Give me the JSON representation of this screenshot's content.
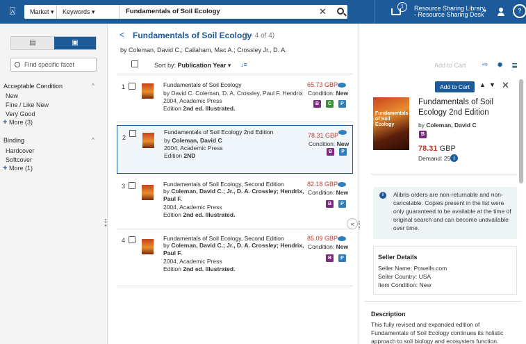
{
  "topbar": {
    "logo_icon": "alma-logo-icon",
    "market_label": "Market ▾",
    "keywords_label": "Keywords ▾",
    "search_value": "Fundamentals of Soil Ecology",
    "clear_glyph": "✕",
    "cart_badge": "1",
    "library_line1": "Resource Sharing Library",
    "library_line2": "- Resource Sharing Desk",
    "chev": "▾",
    "help_label": "?",
    "brand_color": "#1c5a9a"
  },
  "facets": {
    "list_view_glyph": "▤",
    "grid_view_glyph": "▣",
    "search_placeholder": "Find specific facet",
    "groups": [
      {
        "heading": "Acceptable Condition",
        "caret": "^",
        "items": [
          "New",
          "Fine / Like New",
          "Very Good"
        ],
        "more": "More (3)"
      },
      {
        "heading": "Binding",
        "caret": "^",
        "items": [
          "Hardcover",
          "Softcover"
        ],
        "more": "More (1)"
      }
    ],
    "more_plus": "+"
  },
  "results": {
    "back": "<",
    "title": "Fundamentals of Soil Ecology",
    "count": "(1 - 4 of 4)",
    "authors": "by Coleman, David C.; Callaham, Mac A.; Crossley Jr., D. A.",
    "sort_label": "Sort by:",
    "sort_value": "Publication Year",
    "sort_caret": "▾",
    "sort_order_icon": "↓≡",
    "rows": [
      {
        "num": "1",
        "title": "Fundamentals of Soil Ecology",
        "by_prefix": "by ",
        "by": "David C. Coleman, D. A. Crossley, Paul F. Hendrix",
        "by2": "",
        "year": "2004, Academic Press",
        "ed_prefix": "Edition ",
        "edition": "2nd ed. Illustrated.",
        "price": "65.73",
        "currency": "GBP",
        "cond_label": "Condition:",
        "cond": "New",
        "badges": [
          "B",
          "C",
          "P"
        ]
      },
      {
        "num": "2",
        "title": "Fundamentals of Soil Ecology 2nd Edition",
        "by_prefix": "by ",
        "by": "Coleman, David C",
        "by2": "",
        "year": "2004, Academic Press",
        "ed_prefix": "Edition ",
        "edition": "2ND",
        "price": "78.31",
        "currency": "GBP",
        "cond_label": "Condition:",
        "cond": "New",
        "badges": [
          "B",
          "P"
        ]
      },
      {
        "num": "3",
        "title": "Fundamentals of Soil Ecology, Second Edition",
        "by_prefix": "by ",
        "by": "Coleman, David C.; Jr., D. A. Crossley; Hendrix,",
        "by2": "Paul F.",
        "year": "2004, Academic Press",
        "ed_prefix": "Edition ",
        "edition": "2nd ed. Illustrated.",
        "price": "82.18",
        "currency": "GBP",
        "cond_label": "Condition:",
        "cond": "New",
        "badges": [
          "B",
          "P"
        ]
      },
      {
        "num": "4",
        "title": "Fundamentals of Soil Ecology, Second Edition",
        "by_prefix": "by ",
        "by": "Coleman, David C.; Jr., D. A. Crossley; Hendrix,",
        "by2": "Paul F.",
        "year": "2004, Academic Press",
        "ed_prefix": "Edition ",
        "edition": "2nd ed. Illustrated.",
        "price": "85.09",
        "currency": "GBP",
        "cond_label": "Condition:",
        "cond": "New",
        "badges": [
          "B",
          "P"
        ]
      }
    ]
  },
  "detail": {
    "add_to_cart_dim": "Add to Cart",
    "add_to_cart": "Add to Cart",
    "nav_up": "▲",
    "nav_down": "▼",
    "close": "✕",
    "cover_text": "Fundamentals of Soil Ecology",
    "title": "Fundamentals of Soil Ecology 2nd Edition",
    "author_prefix": "by ",
    "author": "Coleman, David C",
    "price": "78.31",
    "currency": "GBP",
    "demand": "Demand: 25",
    "notice": "Alibris orders are non-returnable and non-cancelable. Copies present in the list were only guaranteed to be available at the time of original search and can become unavailable over time.",
    "seller_heading": "Seller Details",
    "seller_name": "Seller Name: Powells.com",
    "seller_country": "Seller Country: USA",
    "item_condition": "Item Condition: New",
    "desc_heading": "Description",
    "desc_text": "This fully revised and expanded edition of Fundamentals of Soil Ecology continues its holistic approach to soil biology and ecosystem function.",
    "collapse": "«"
  }
}
